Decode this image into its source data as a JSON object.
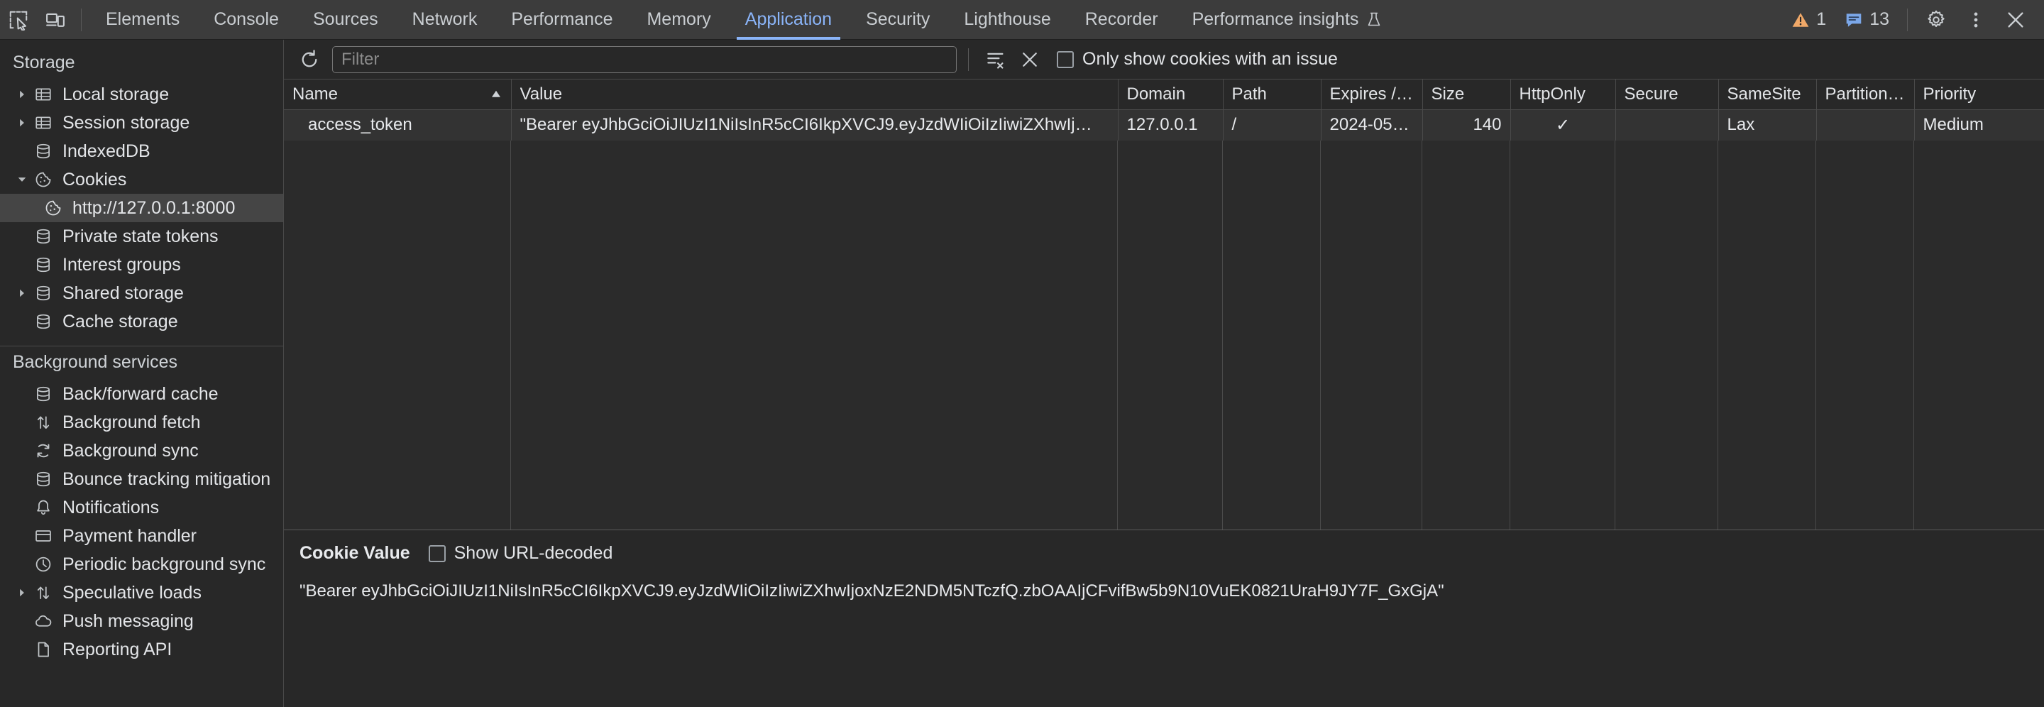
{
  "toolbar": {
    "inspect_icon": "inspect-element-icon",
    "device_icon": "device-toolbar-icon",
    "tabs": [
      {
        "label": "Elements",
        "active": false
      },
      {
        "label": "Console",
        "active": false
      },
      {
        "label": "Sources",
        "active": false
      },
      {
        "label": "Network",
        "active": false
      },
      {
        "label": "Performance",
        "active": false
      },
      {
        "label": "Memory",
        "active": false
      },
      {
        "label": "Application",
        "active": true
      },
      {
        "label": "Security",
        "active": false
      },
      {
        "label": "Lighthouse",
        "active": false
      },
      {
        "label": "Recorder",
        "active": false
      },
      {
        "label": "Performance insights",
        "active": false,
        "icon": "flask-icon"
      }
    ],
    "warning_count": "1",
    "message_count": "13",
    "warning_color": "#f0a868",
    "message_color": "#7ba7e8",
    "accent_color": "#8ab4f8",
    "settings_icon": "gear-icon",
    "more_icon": "kebab-menu-icon",
    "close_icon": "close-icon"
  },
  "sidebar": {
    "storage_title": "Storage",
    "storage_items": [
      {
        "label": "Local storage",
        "icon": "table-icon",
        "twisty": "collapsed",
        "indent": 1,
        "selected": false
      },
      {
        "label": "Session storage",
        "icon": "table-icon",
        "twisty": "collapsed",
        "indent": 1,
        "selected": false
      },
      {
        "label": "IndexedDB",
        "icon": "database-icon",
        "twisty": "none",
        "indent": 1,
        "selected": false
      },
      {
        "label": "Cookies",
        "icon": "cookie-icon",
        "twisty": "expanded",
        "indent": 1,
        "selected": false
      },
      {
        "label": "http://127.0.0.1:8000",
        "icon": "cookie-icon",
        "twisty": "none",
        "indent": 2,
        "selected": true
      },
      {
        "label": "Private state tokens",
        "icon": "database-icon",
        "twisty": "none",
        "indent": 1,
        "selected": false
      },
      {
        "label": "Interest groups",
        "icon": "database-icon",
        "twisty": "none",
        "indent": 1,
        "selected": false
      },
      {
        "label": "Shared storage",
        "icon": "database-icon",
        "twisty": "collapsed",
        "indent": 1,
        "selected": false
      },
      {
        "label": "Cache storage",
        "icon": "database-icon",
        "twisty": "none",
        "indent": 1,
        "selected": false
      }
    ],
    "background_title": "Background services",
    "background_items": [
      {
        "label": "Back/forward cache",
        "icon": "database-icon",
        "twisty": "none",
        "indent": 1,
        "selected": false
      },
      {
        "label": "Background fetch",
        "icon": "updown-arrows-icon",
        "twisty": "none",
        "indent": 1,
        "selected": false
      },
      {
        "label": "Background sync",
        "icon": "sync-icon",
        "twisty": "none",
        "indent": 1,
        "selected": false
      },
      {
        "label": "Bounce tracking mitigation",
        "icon": "database-icon",
        "twisty": "none",
        "indent": 1,
        "selected": false
      },
      {
        "label": "Notifications",
        "icon": "bell-icon",
        "twisty": "none",
        "indent": 1,
        "selected": false
      },
      {
        "label": "Payment handler",
        "icon": "credit-card-icon",
        "twisty": "none",
        "indent": 1,
        "selected": false
      },
      {
        "label": "Periodic background sync",
        "icon": "clock-icon",
        "twisty": "none",
        "indent": 1,
        "selected": false
      },
      {
        "label": "Speculative loads",
        "icon": "updown-arrows-icon",
        "twisty": "collapsed",
        "indent": 1,
        "selected": false
      },
      {
        "label": "Push messaging",
        "icon": "cloud-icon",
        "twisty": "none",
        "indent": 1,
        "selected": false
      },
      {
        "label": "Reporting API",
        "icon": "document-icon",
        "twisty": "none",
        "indent": 1,
        "selected": false
      }
    ]
  },
  "filterbar": {
    "refresh_icon": "refresh-icon",
    "filter_placeholder": "Filter",
    "filter_value": "",
    "clear_filtered_icon": "clear-filtered-icon",
    "clear_all_icon": "clear-all-icon",
    "issue_checkbox_label": "Only show cookies with an issue",
    "issue_checkbox_checked": false
  },
  "table": {
    "columns": [
      {
        "label": "Name",
        "sort": "asc"
      },
      {
        "label": "Value",
        "sort": "none"
      },
      {
        "label": "Domain",
        "sort": "none"
      },
      {
        "label": "Path",
        "sort": "none"
      },
      {
        "label": "Expires / ...",
        "sort": "none"
      },
      {
        "label": "Size",
        "sort": "none"
      },
      {
        "label": "HttpOnly",
        "sort": "none"
      },
      {
        "label": "Secure",
        "sort": "none"
      },
      {
        "label": "SameSite",
        "sort": "none"
      },
      {
        "label": "Partition ...",
        "sort": "none"
      },
      {
        "label": "Priority",
        "sort": "none"
      }
    ],
    "rows": [
      {
        "name": "access_token",
        "value": "\"Bearer eyJhbGciOiJIUzI1NiIsInR5cCI6IkpXVCJ9.eyJzdWIiOiIzIiwiZXhwIj…",
        "domain": "127.0.0.1",
        "path": "/",
        "expires": "2024-05…",
        "size": "140",
        "httponly": "✓",
        "secure": "",
        "samesite": "Lax",
        "partition": "",
        "priority": "Medium"
      }
    ]
  },
  "bottom_panel": {
    "title": "Cookie Value",
    "url_decoded_label": "Show URL-decoded",
    "url_decoded_checked": false,
    "value": "\"Bearer eyJhbGciOiJIUzI1NiIsInR5cCI6IkpXVCJ9.eyJzdWIiOiIzIiwiZXhwIjoxNzE2NDM5NTczfQ.zbOAAIjCFvifBw5b9N10VuEK0821UraH9JY7F_GxGjA\""
  }
}
